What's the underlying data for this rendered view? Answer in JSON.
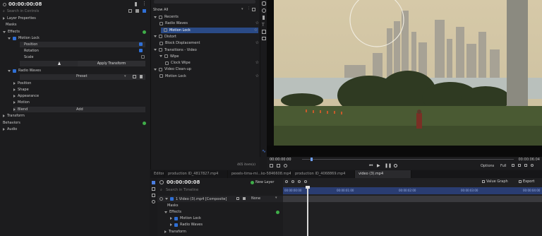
{
  "left": {
    "timecode": "00:00:00:08",
    "search_placeholder": "Search in Controls",
    "layer_properties": "Layer Properties",
    "masks": "Masks",
    "effects": "Effects",
    "motion_lock": "Motion Lock",
    "position": "Position",
    "rotation": "Rotation",
    "scale": "Scale",
    "apply_transform": "Apply Transform",
    "radio_waves": "Radio Waves",
    "preset": "Preset",
    "rw_position": "Position",
    "shape": "Shape",
    "appearance": "Appearance",
    "motion": "Motion",
    "blend": "Blend",
    "blend_value": "Add",
    "transform": "Transform",
    "behaviors": "Behaviors",
    "audio": "Audio"
  },
  "library": {
    "header": "Show All",
    "items": [
      {
        "label": "Recents",
        "level": 0,
        "type": "folder"
      },
      {
        "label": "Radio Waves",
        "level": 1,
        "type": "fx"
      },
      {
        "label": "Motion Lock",
        "level": 1,
        "type": "fx",
        "selected": true
      },
      {
        "label": "Distort",
        "level": 0,
        "type": "folder"
      },
      {
        "label": "Block Displacement",
        "level": 1,
        "type": "fx"
      },
      {
        "label": "Transitions - Video",
        "level": 0,
        "type": "folder"
      },
      {
        "label": "Wipe",
        "level": 1,
        "type": "folder"
      },
      {
        "label": "Clock Wipe",
        "level": 2,
        "type": "fx"
      },
      {
        "label": "Video Clean-up",
        "level": 0,
        "type": "folder"
      },
      {
        "label": "Motion Lock",
        "level": 1,
        "type": "fx"
      }
    ],
    "count": "465 item(s)"
  },
  "viewer": {
    "timecode": "00:00:00:00",
    "end_timecode": "00:00:06:04",
    "options_label": "Options",
    "zoom_label": "Full"
  },
  "tabs": [
    {
      "label": "Editor"
    },
    {
      "label": "production ID_4817827.mp4"
    },
    {
      "label": "pexels-tima-mi...ko-5846608.mp4"
    },
    {
      "label": "production ID_4068869.mp4"
    },
    {
      "label": "video (3).mp4",
      "active": true
    }
  ],
  "timeline": {
    "timecode": "00:00:00:08",
    "new_layer": "New Layer",
    "value_graph": "Value Graph",
    "export": "Export",
    "search_placeholder": "Search in Timeline",
    "layer_name": "1 Video (3).mp4 [Composite]",
    "blend": "None",
    "masks": "Masks",
    "effects": "Effects",
    "motion_lock": "Motion Lock",
    "radio_waves": "Radio Waves",
    "transform": "Transform",
    "ruler": [
      "00:00:00:00",
      "00:00:01:00",
      "00:00:02:00",
      "00:00:03:00",
      "00:00:04:00"
    ]
  }
}
